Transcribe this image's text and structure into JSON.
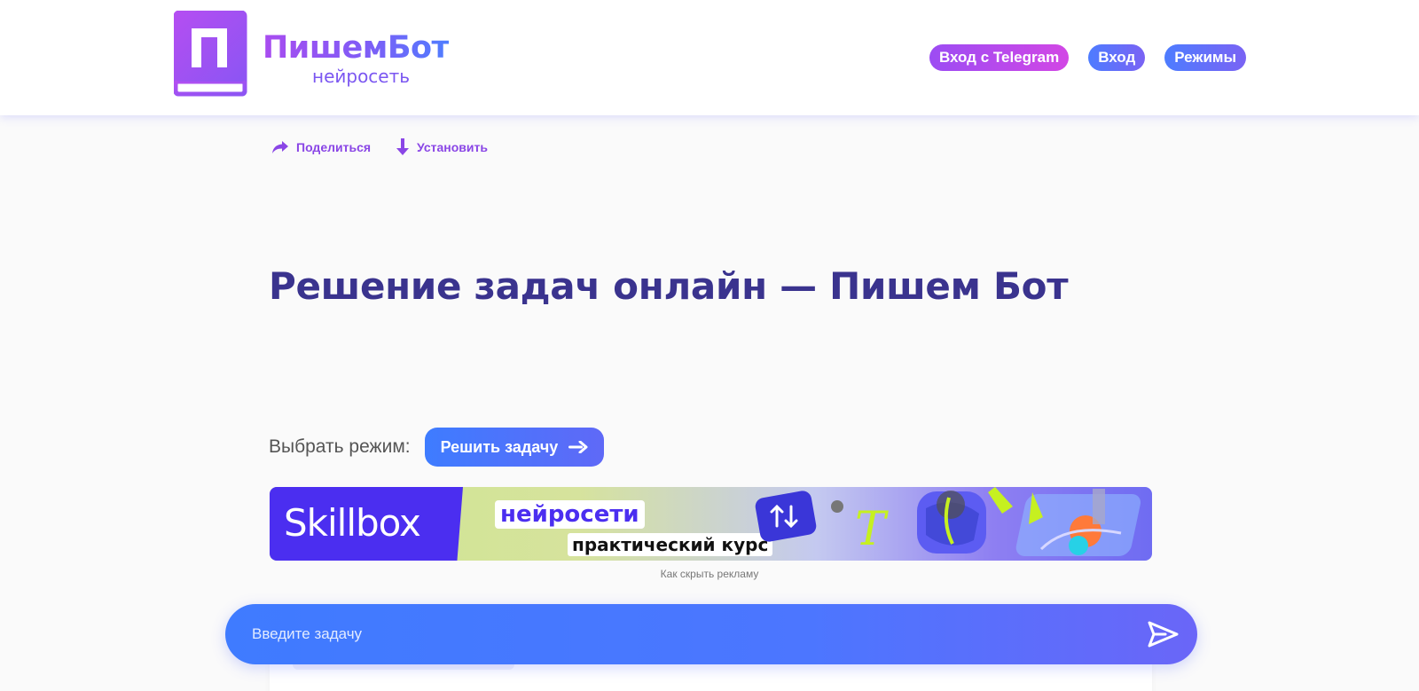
{
  "header": {
    "logo": {
      "mark_letter": "П",
      "name": "ПишемБот",
      "subtitle": "нейросеть"
    },
    "nav": {
      "telegram_login": "Вход с Telegram",
      "login": "Вход",
      "modes": "Режимы"
    }
  },
  "toolbar": {
    "share": {
      "label": "Поделиться",
      "icon": "share-arrow-icon"
    },
    "install": {
      "label": "Установить",
      "icon": "download-arrow-icon"
    }
  },
  "page": {
    "title": "Решение задач онлайн — Пишем Бот"
  },
  "mode_select": {
    "label": "Выбрать режим:",
    "current_mode": "Решить задачу",
    "icon": "arrow-right-icon"
  },
  "ad": {
    "brand": "Skillbox",
    "headline": "нейросети",
    "subheadline": "практический курс",
    "hint": "Как скрыть рекламу"
  },
  "input": {
    "placeholder": "Введите задачу",
    "value": "",
    "send_icon": "send-paper-plane-icon"
  },
  "colors": {
    "primary_blue": "#3f7bff",
    "accent_purple": "#9c4cf3",
    "telegram_pink": "#d247e5",
    "title": "#3a338e",
    "skillbox_blue": "#4b2ef0"
  }
}
